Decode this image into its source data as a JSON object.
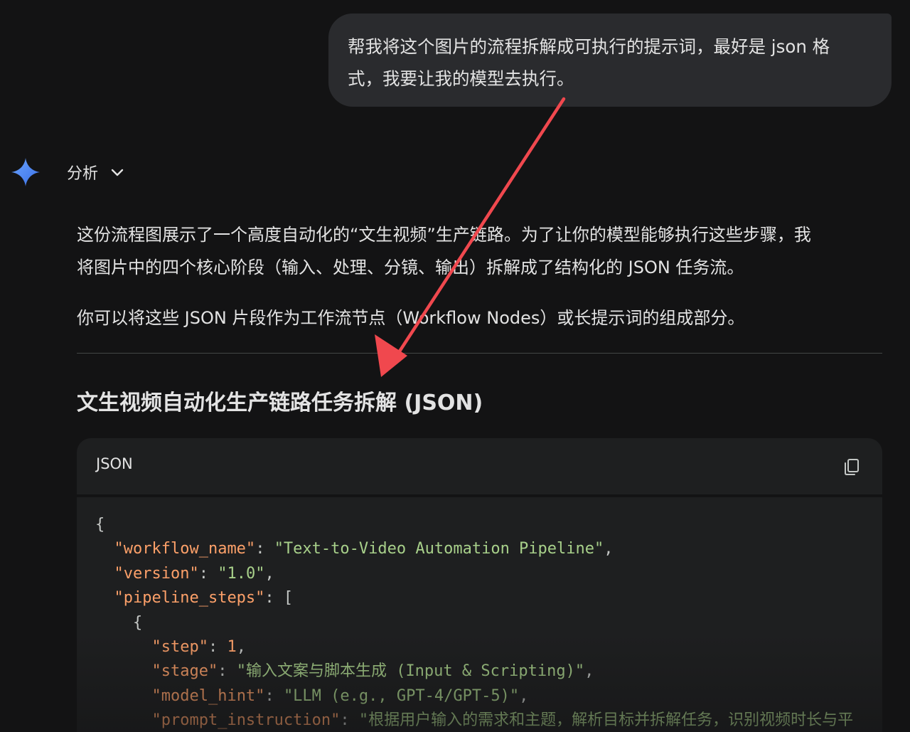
{
  "user_message": {
    "line1": "帮我将这个图片的流程拆解成可执行的提示词，最好是 json 格",
    "line2": "式，我要让我的模型去执行。"
  },
  "assistant": {
    "analysis_label": "分析",
    "paragraph1_line1": "这份流程图展示了一个高度自动化的“文生视频”生产链路。为了让你的模型能够执行这些步骤，我",
    "paragraph1_line2": "将图片中的四个核心阶段（输入、处理、分镜、输出）拆解成了结构化的 JSON 任务流。",
    "paragraph2": "你可以将这些 JSON 片段作为工作流节点（Workflow Nodes）或长提示词的组成部分。",
    "section_title": "文生视频自动化生产链路任务拆解 (JSON)"
  },
  "code_block": {
    "language": "JSON",
    "lines": {
      "l1_brace": "{",
      "l2_key": "\"workflow_name\"",
      "l2_val": "\"Text-to-Video Automation Pipeline\"",
      "l3_key": "\"version\"",
      "l3_val": "\"1.0\"",
      "l4_key": "\"pipeline_steps\"",
      "l4_val": "[",
      "l5_brace": "{",
      "l6_key": "\"step\"",
      "l6_val": "1",
      "l7_key": "\"stage\"",
      "l7_val": "\"输入文案与脚本生成 (Input & Scripting)\"",
      "l8_key": "\"model_hint\"",
      "l8_val": "\"LLM (e.g., GPT-4/GPT-5)\"",
      "l9_key": "\"prompt_instruction\"",
      "l9_val": "\"根据用户输入的需求和主题，解析目标并拆解任务，识别视频时长与平"
    }
  },
  "colors": {
    "background": "#131314",
    "bubble": "#2a2b2e",
    "code_bg": "#1e1f20",
    "json_key": "#fca069",
    "json_string": "#a8d08a",
    "annotation_arrow": "#f0484e",
    "gem_blue": "#4f8df7"
  },
  "icons": {
    "assistant_logo": "gemini-sparkle-icon",
    "toggle": "chevron-down-icon",
    "copy": "copy-icon",
    "annotation": "red-arrow-annotation"
  }
}
